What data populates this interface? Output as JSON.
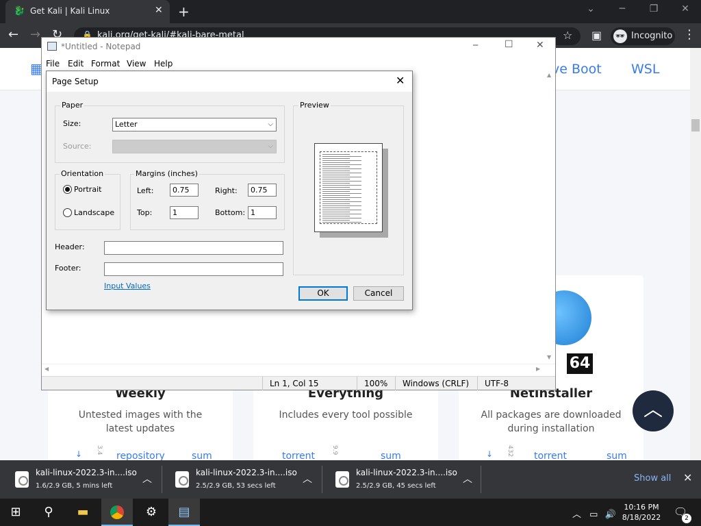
{
  "chrome": {
    "tab_title": "Get Kali | Kali Linux",
    "url": "kali.org/get-kali/#kali-bare-metal",
    "incognito_label": "Incognito"
  },
  "webpage": {
    "nav": [
      "ve Boot",
      "WSL"
    ],
    "cards": [
      {
        "title": "Weekly",
        "desc": "Untested images with the latest updates",
        "links": [
          "repository",
          "sum"
        ],
        "side": "3.4"
      },
      {
        "title": "Everything",
        "desc": "Includes every tool possible",
        "links": [
          "torrent",
          "sum"
        ],
        "side": "9.9"
      },
      {
        "title": "NetInstaller",
        "desc": "All packages are downloaded during installation",
        "links": [
          "torrent",
          "sum"
        ],
        "side": "432"
      }
    ],
    "badge": "64"
  },
  "notepad": {
    "title": "*Untitled - Notepad",
    "menu": [
      "File",
      "Edit",
      "Format",
      "View",
      "Help"
    ],
    "status": {
      "position": "Ln 1, Col 15",
      "zoom": "100%",
      "line_ending": "Windows (CRLF)",
      "encoding": "UTF-8"
    }
  },
  "page_setup": {
    "title": "Page Setup",
    "paper_label": "Paper",
    "size_label": "Size:",
    "size_value": "Letter",
    "source_label": "Source:",
    "orientation_label": "Orientation",
    "portrait_label": "Portrait",
    "landscape_label": "Landscape",
    "orientation_selected": "Portrait",
    "margins_label": "Margins (inches)",
    "left_label": "Left:",
    "left_value": "0.75",
    "right_label": "Right:",
    "right_value": "0.75",
    "top_label": "Top:",
    "top_value": "1",
    "bottom_label": "Bottom:",
    "bottom_value": "1",
    "header_label": "Header:",
    "header_value": "",
    "footer_label": "Footer:",
    "footer_value": "",
    "input_values_link": "Input Values",
    "preview_label": "Preview",
    "ok_label": "OK",
    "cancel_label": "Cancel"
  },
  "downloads": {
    "items": [
      {
        "name": "kali-linux-2022.3-in....iso",
        "meta": "1.6/2.9 GB, 5 mins left"
      },
      {
        "name": "kali-linux-2022.3-in....iso",
        "meta": "2.5/2.9 GB, 53 secs left"
      },
      {
        "name": "kali-linux-2022.3-in....iso",
        "meta": "2.5/2.9 GB, 45 secs left"
      }
    ],
    "show_all": "Show all"
  },
  "taskbar": {
    "time": "10:16 PM",
    "date": "8/18/2022",
    "notification_count": "2"
  },
  "colors": {
    "accent_link": "#367bf0",
    "dialog_default_border": "#0078d7"
  }
}
